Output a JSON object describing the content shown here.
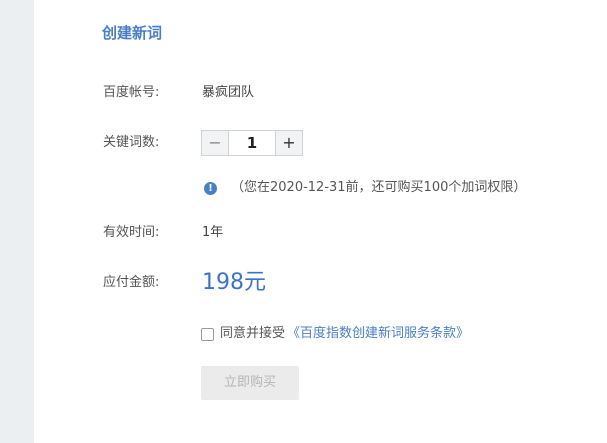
{
  "page": {
    "title": "创建新词"
  },
  "form": {
    "account": {
      "label": "百度帐号:",
      "value": "暴疯团队"
    },
    "keywords": {
      "label": "关键词数:",
      "minus": "−",
      "plus": "+",
      "quantity": "1"
    },
    "notice": {
      "icon": "!",
      "text": "（您在2020-12-31前，还可购买100个加词权限）"
    },
    "duration": {
      "label": "有效时间:",
      "value": "1年"
    },
    "amount": {
      "label": "应付金额:",
      "value": "198元"
    },
    "agreement": {
      "text": "同意并接受",
      "link": "《百度指数创建新词服务条款》",
      "checked": false
    },
    "buy_button": "立即购买"
  },
  "colors": {
    "accent": "#4a7fc7",
    "price": "#3b74c6",
    "sidebar_strip": "#ebeff2",
    "disabled_button_bg": "#ebebeb"
  }
}
